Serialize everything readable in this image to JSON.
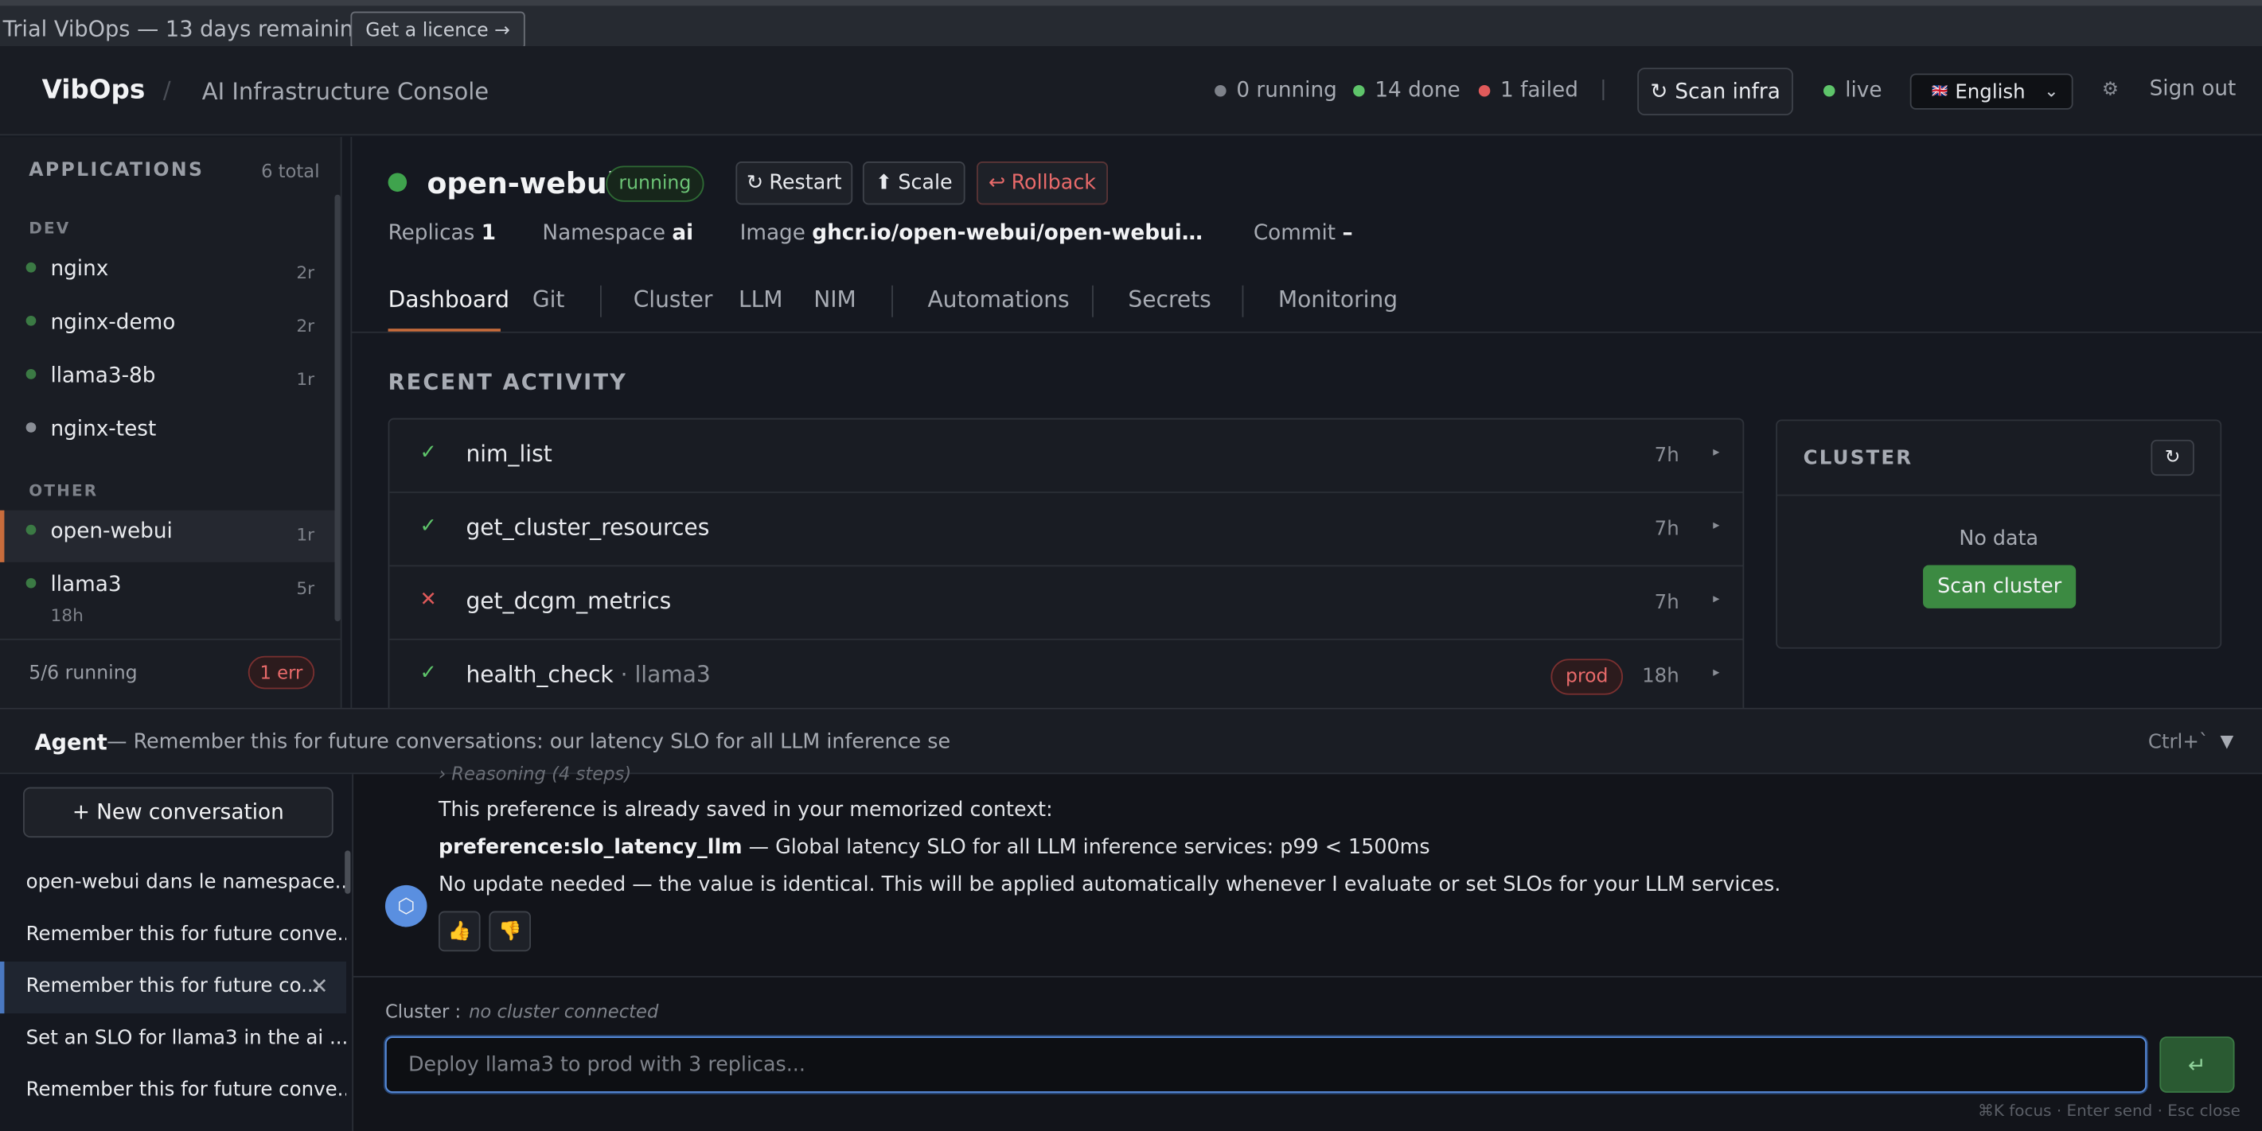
{
  "trial": {
    "text": "Trial VibOps — 13 days remaining",
    "licence_button": "Get a licence →"
  },
  "header": {
    "brand": "VibOps",
    "separator": "/",
    "console_title": "AI Infrastructure Console",
    "stats": {
      "running": "0 running",
      "done": "14 done",
      "failed": "1 failed"
    },
    "stat_colors": {
      "running": "#7e828a",
      "done": "#5ec46a",
      "failed": "#e05a5a"
    },
    "scan_button": "Scan infra",
    "live_label": "live",
    "language": "English",
    "language_flag": "🇬🇧",
    "sign_out": "Sign out"
  },
  "sidebar": {
    "title": "APPLICATIONS",
    "total": "6 total",
    "groups": [
      {
        "label": "DEV"
      },
      {
        "label": "OTHER"
      }
    ],
    "items": [
      {
        "name": "nginx",
        "count": "2r",
        "status": "green"
      },
      {
        "name": "nginx-demo",
        "count": "2r",
        "status": "green"
      },
      {
        "name": "llama3-8b",
        "count": "1r",
        "status": "green"
      },
      {
        "name": "nginx-test",
        "count": "",
        "status": "gray"
      },
      {
        "name": "open-webui",
        "count": "1r",
        "status": "green"
      },
      {
        "name": "llama3",
        "count": "5r",
        "status": "green",
        "age": "18h"
      }
    ],
    "running_summary": "5/6 running",
    "error_badge": "1 err"
  },
  "app": {
    "name": "open-webui",
    "status": "running",
    "actions": {
      "restart": "Restart",
      "scale": "Scale",
      "rollback": "Rollback"
    },
    "meta": {
      "replicas_label": "Replicas",
      "replicas": "1",
      "namespace_label": "Namespace",
      "namespace": "ai",
      "image_label": "Image",
      "image": "ghcr.io/open-webui/open-webui…",
      "commit_label": "Commit",
      "commit": "–"
    },
    "tabs": [
      "Dashboard",
      "Git",
      "Cluster",
      "LLM",
      "NIM",
      "Automations",
      "Secrets",
      "Monitoring"
    ]
  },
  "activity": {
    "title": "RECENT ACTIVITY",
    "rows": [
      {
        "status": "ok",
        "mark": "✓",
        "tool": "nim_list",
        "sub": "",
        "badge": "",
        "time": "7h"
      },
      {
        "status": "ok",
        "mark": "✓",
        "tool": "get_cluster_resources",
        "sub": "",
        "badge": "",
        "time": "7h"
      },
      {
        "status": "fail",
        "mark": "✕",
        "tool": "get_dcgm_metrics",
        "sub": "",
        "badge": "",
        "time": "7h"
      },
      {
        "status": "ok",
        "mark": "✓",
        "tool": "health_check",
        "sub": " · llama3",
        "badge": "prod",
        "time": "18h"
      }
    ]
  },
  "cluster_card": {
    "title": "CLUSTER",
    "empty": "No data",
    "scan_button": "Scan cluster"
  },
  "agent": {
    "title": "Agent",
    "subtitle": "— Remember this for future conversations: our latency SLO for all LLM inference se",
    "shortcut": "Ctrl+`",
    "collapse": "▼",
    "new_conversation": "+ New conversation",
    "conversations": [
      "open-webui dans le namespace...",
      "Remember this for future conve...",
      "Remember this for future co...",
      "Set an SLO for llama3 in the ai ...",
      "Remember this for future conve..."
    ],
    "active_conversation": 2,
    "reasoning_hint": "› Reasoning (4 steps)",
    "messages": {
      "line1": "This preference is already saved in your memorized context:",
      "line2_key": "preference:slo_latency_llm",
      "line2_text": " — Global latency SLO for all LLM inference services: p99 < 1500ms",
      "line3": "No update needed — the value is identical. This will be applied automatically whenever I evaluate or set SLOs for your LLM services."
    },
    "cluster_label": "Cluster :",
    "cluster_value": "no cluster connected",
    "input_placeholder": "Deploy llama3 to prod with 3 replicas...",
    "send": "↵",
    "key_hints": "⌘K focus · Enter send · Esc close"
  }
}
